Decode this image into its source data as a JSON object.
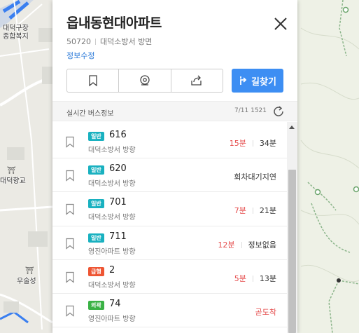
{
  "map": {
    "labels": {
      "welfare": "대덕구장\n종합복지",
      "hyanggyo": "대덕향교",
      "usulseong": "우술성"
    },
    "pin_glyph": "⛩"
  },
  "panel": {
    "title": "읍내동현대아파트",
    "stop_id": "50720",
    "direction": "대덕소방서 방면",
    "edit_label": "정보수정",
    "route_button_label": "길찾기",
    "realtime_title": "실시간 버스정보",
    "realtime_time": "7/11 1521"
  },
  "buses": [
    {
      "type": "일반",
      "type_color": "#19b1c0",
      "number": "616",
      "direction": "대덕소방서 방향",
      "arrival": "15분",
      "arrival_red": true,
      "next": "34분"
    },
    {
      "type": "일반",
      "type_color": "#19b1c0",
      "number": "620",
      "direction": "대덕소방서 방향",
      "arrival": "",
      "arrival_red": false,
      "next": "회차대기지연"
    },
    {
      "type": "일반",
      "type_color": "#19b1c0",
      "number": "701",
      "direction": "대덕소방서 방향",
      "arrival": "7분",
      "arrival_red": true,
      "next": "21분"
    },
    {
      "type": "일반",
      "type_color": "#19b1c0",
      "number": "711",
      "direction": "영진아파트 방향",
      "arrival": "12분",
      "arrival_red": true,
      "next": "정보없음"
    },
    {
      "type": "급행",
      "type_color": "#ee5533",
      "number": "2",
      "direction": "대덕소방서 방향",
      "arrival": "5분",
      "arrival_red": true,
      "next": "13분"
    },
    {
      "type": "외곽",
      "type_color": "#3ab245",
      "number": "74",
      "direction": "영진아파트 방향",
      "arrival": "곧도착",
      "arrival_red": true,
      "next": ""
    }
  ],
  "colors": {
    "accent": "#3d8ef3",
    "red": "#e54b4b"
  }
}
